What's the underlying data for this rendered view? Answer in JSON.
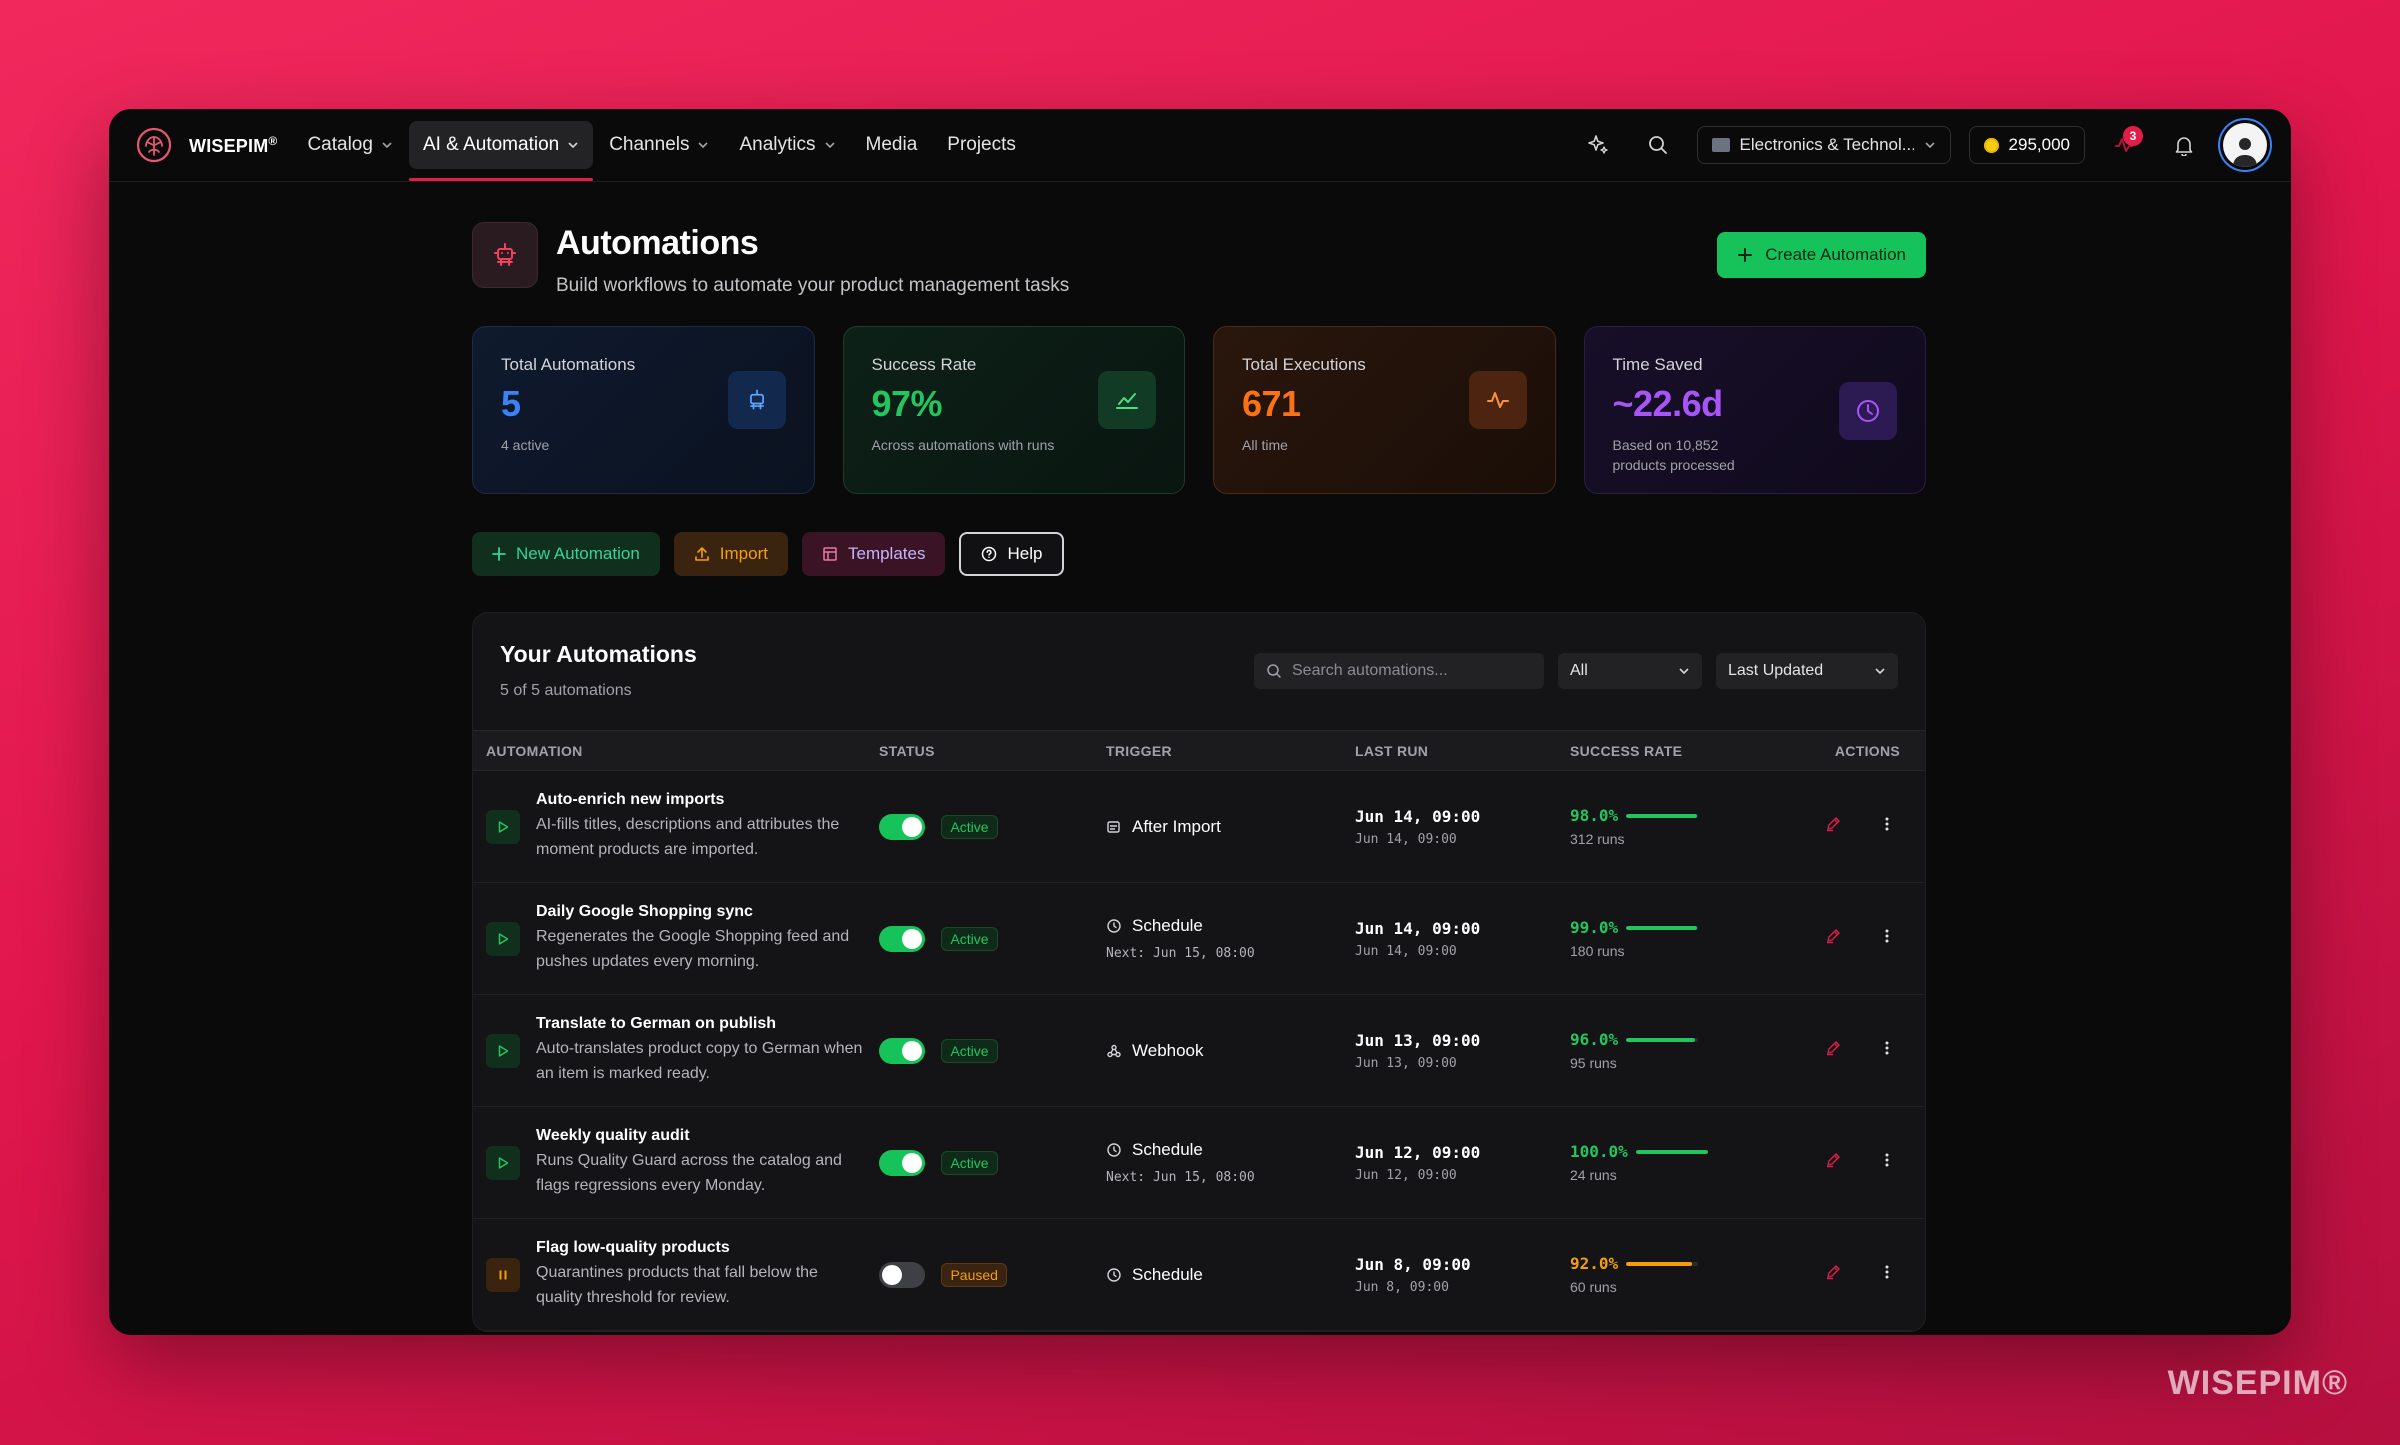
{
  "brand": {
    "name": "WISEPIM",
    "mark": "®"
  },
  "nav": {
    "items": [
      {
        "label": "Catalog",
        "dropdown": true
      },
      {
        "label": "AI & Automation",
        "dropdown": true,
        "active": true
      },
      {
        "label": "Channels",
        "dropdown": true
      },
      {
        "label": "Analytics",
        "dropdown": true
      },
      {
        "label": "Media",
        "dropdown": false
      },
      {
        "label": "Projects",
        "dropdown": false
      }
    ],
    "workspace": "Electronics & Technol...",
    "credits": "295,000",
    "notification_count": "3"
  },
  "page": {
    "title": "Automations",
    "subtitle": "Build workflows to automate your product management tasks",
    "create_button": "Create Automation"
  },
  "stats": [
    {
      "label": "Total Automations",
      "value": "5",
      "note": "4 active",
      "color": "#3b82f6"
    },
    {
      "label": "Success Rate",
      "value": "97%",
      "note": "Across automations with runs",
      "color": "#22c55e"
    },
    {
      "label": "Total Executions",
      "value": "671",
      "note": "All time",
      "color": "#f97316"
    },
    {
      "label": "Time Saved",
      "value": "~22.6d",
      "note": "Based on 10,852 products processed",
      "color": "#a855f7"
    }
  ],
  "actions": {
    "new": "New Automation",
    "import": "Import",
    "templates": "Templates",
    "help": "Help"
  },
  "list": {
    "title": "Your Automations",
    "count": "5 of 5 automations",
    "search_placeholder": "Search automations...",
    "filter": "All",
    "sort": "Last Updated",
    "columns": [
      "AUTOMATION",
      "STATUS",
      "TRIGGER",
      "LAST RUN",
      "SUCCESS RATE",
      "ACTIONS"
    ],
    "rows": [
      {
        "name": "Auto-enrich new imports",
        "desc": "AI-fills titles, descriptions and attributes the moment products are imported.",
        "enabled": true,
        "status": "Active",
        "trigger": "After Import",
        "trigger_icon": "import-icon",
        "next": "",
        "last_run": "Jun 14, 09:00",
        "last_run_sub": "Jun 14, 09:00",
        "rate": "98.0%",
        "rate_value": 98.0,
        "runs": "312 runs"
      },
      {
        "name": "Daily Google Shopping sync",
        "desc": "Regenerates the Google Shopping feed and pushes updates every morning.",
        "enabled": true,
        "status": "Active",
        "trigger": "Schedule",
        "trigger_icon": "clock-icon",
        "next": "Next: Jun 15, 08:00",
        "last_run": "Jun 14, 09:00",
        "last_run_sub": "Jun 14, 09:00",
        "rate": "99.0%",
        "rate_value": 99.0,
        "runs": "180 runs"
      },
      {
        "name": "Translate to German on publish",
        "desc": "Auto-translates product copy to German when an item is marked ready.",
        "enabled": true,
        "status": "Active",
        "trigger": "Webhook",
        "trigger_icon": "webhook-icon",
        "next": "",
        "last_run": "Jun 13, 09:00",
        "last_run_sub": "Jun 13, 09:00",
        "rate": "96.0%",
        "rate_value": 96.0,
        "runs": "95 runs"
      },
      {
        "name": "Weekly quality audit",
        "desc": "Runs Quality Guard across the catalog and flags regressions every Monday.",
        "enabled": true,
        "status": "Active",
        "trigger": "Schedule",
        "trigger_icon": "clock-icon",
        "next": "Next: Jun 15, 08:00",
        "last_run": "Jun 12, 09:00",
        "last_run_sub": "Jun 12, 09:00",
        "rate": "100.0%",
        "rate_value": 100.0,
        "runs": "24 runs"
      },
      {
        "name": "Flag low-quality products",
        "desc": "Quarantines products that fall below the quality threshold for review.",
        "enabled": false,
        "status": "Paused",
        "trigger": "Schedule",
        "trigger_icon": "clock-icon",
        "next": "",
        "last_run": "Jun 8, 09:00",
        "last_run_sub": "Jun 8, 09:00",
        "rate": "92.0%",
        "rate_value": 92.0,
        "runs": "60 runs"
      }
    ]
  },
  "watermark": "WISEPIM®",
  "colors": {
    "accent": "#e11d48",
    "success": "#22c55e",
    "warning": "#f59e0b"
  }
}
